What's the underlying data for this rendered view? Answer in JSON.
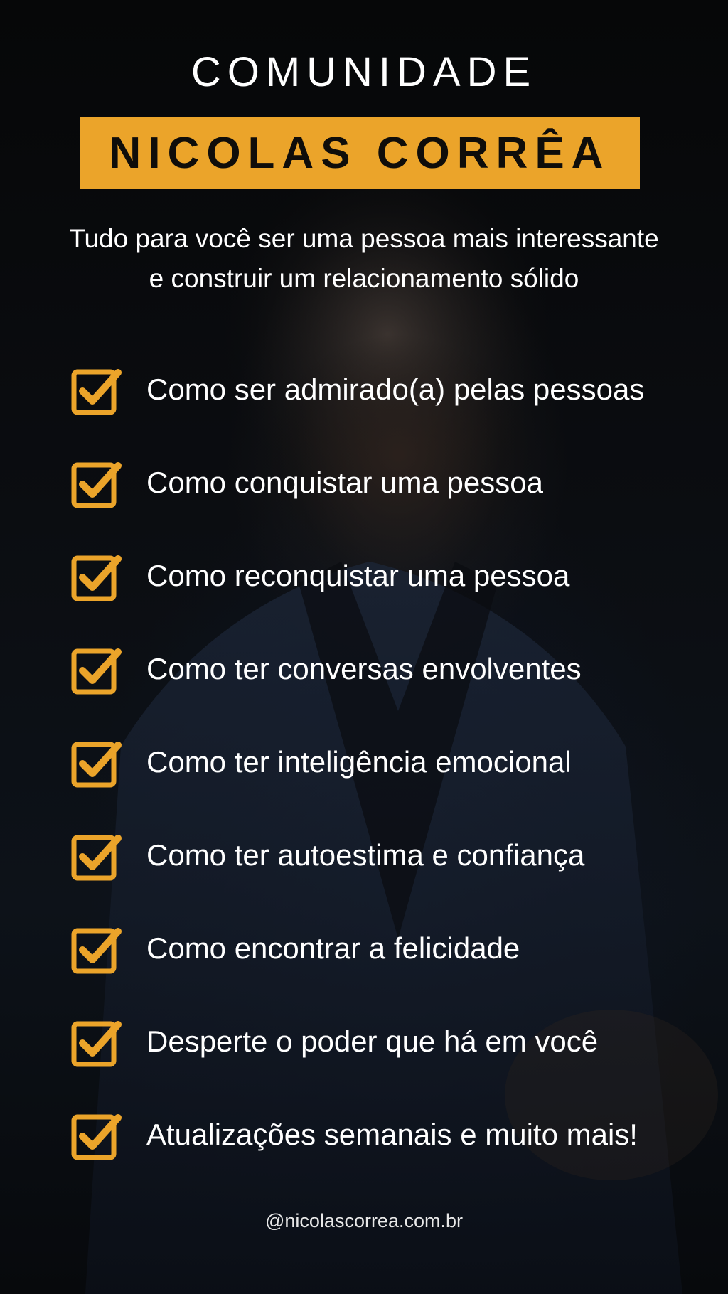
{
  "header": {
    "kicker": "COMUNIDADE",
    "name": "NICOLAS CORRÊA"
  },
  "subtitle": {
    "line1": "Tudo para você ser uma pessoa mais interessante",
    "line2": "e construir um relacionamento sólido"
  },
  "benefits": [
    {
      "label": "Como ser admirado(a) pelas pessoas",
      "icon": "checkbox-checked-icon"
    },
    {
      "label": "Como conquistar uma pessoa",
      "icon": "checkbox-checked-icon"
    },
    {
      "label": "Como reconquistar uma pessoa",
      "icon": "checkbox-checked-icon"
    },
    {
      "label": "Como ter conversas envolventes",
      "icon": "checkbox-checked-icon"
    },
    {
      "label": "Como ter inteligência emocional",
      "icon": "checkbox-checked-icon"
    },
    {
      "label": "Como ter autoestima e confiança",
      "icon": "checkbox-checked-icon"
    },
    {
      "label": "Como encontrar a felicidade",
      "icon": "checkbox-checked-icon"
    },
    {
      "label": "Desperte o poder que há em você",
      "icon": "checkbox-checked-icon"
    },
    {
      "label": "Atualizações semanais e muito mais!",
      "icon": "checkbox-checked-icon"
    }
  ],
  "footer": {
    "handle": "@nicolascorrea.com.br"
  },
  "colors": {
    "accent": "#eba42a",
    "background": "#08090b",
    "text": "#ffffff"
  }
}
